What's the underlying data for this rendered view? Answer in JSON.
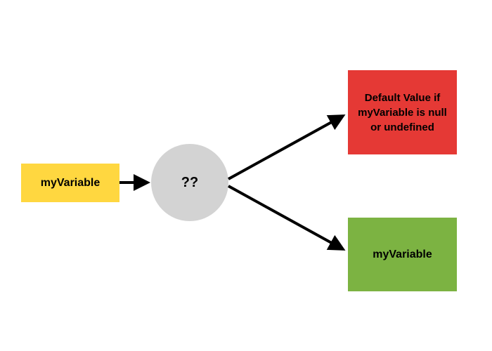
{
  "diagram": {
    "input": {
      "label": "myVariable"
    },
    "operator": {
      "label": "??"
    },
    "output_nullish": {
      "label": "Default Value if myVariable is null or undefined"
    },
    "output_value": {
      "label": "myVariable"
    }
  },
  "colors": {
    "input": "#ffd740",
    "operator": "#d3d3d3",
    "output_nullish": "#e53935",
    "output_value": "#7cb342",
    "arrow": "#000000"
  }
}
